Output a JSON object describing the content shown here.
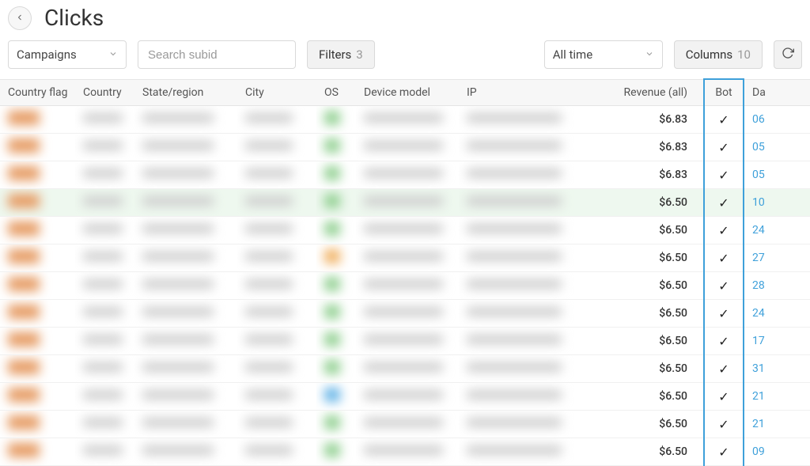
{
  "header": {
    "title": "Clicks"
  },
  "toolbar": {
    "campaigns_label": "Campaigns",
    "search_placeholder": "Search subid",
    "filters_label": "Filters",
    "filters_count": "3",
    "time_label": "All time",
    "columns_label": "Columns",
    "columns_count": "10"
  },
  "columns": {
    "flag": "Country flag",
    "country": "Country",
    "state": "State/region",
    "city": "City",
    "os": "OS",
    "device": "Device model",
    "ip": "IP",
    "revenue": "Revenue (all)",
    "bot": "Bot",
    "date": "Da"
  },
  "rows": [
    {
      "revenue": "$6.83",
      "bot": true,
      "date": "06",
      "highlight": false,
      "os_color": "green"
    },
    {
      "revenue": "$6.83",
      "bot": true,
      "date": "05",
      "highlight": false,
      "os_color": "green"
    },
    {
      "revenue": "$6.83",
      "bot": true,
      "date": "05",
      "highlight": false,
      "os_color": "green"
    },
    {
      "revenue": "$6.50",
      "bot": true,
      "date": "10",
      "highlight": true,
      "os_color": "green"
    },
    {
      "revenue": "$6.50",
      "bot": true,
      "date": "24",
      "highlight": false,
      "os_color": "green"
    },
    {
      "revenue": "$6.50",
      "bot": true,
      "date": "27",
      "highlight": false,
      "os_color": "orange"
    },
    {
      "revenue": "$6.50",
      "bot": true,
      "date": "28",
      "highlight": false,
      "os_color": "green"
    },
    {
      "revenue": "$6.50",
      "bot": true,
      "date": "24",
      "highlight": false,
      "os_color": "green"
    },
    {
      "revenue": "$6.50",
      "bot": true,
      "date": "17",
      "highlight": false,
      "os_color": "green"
    },
    {
      "revenue": "$6.50",
      "bot": true,
      "date": "31",
      "highlight": false,
      "os_color": "green"
    },
    {
      "revenue": "$6.50",
      "bot": true,
      "date": "21",
      "highlight": false,
      "os_color": "blue"
    },
    {
      "revenue": "$6.50",
      "bot": true,
      "date": "21",
      "highlight": false,
      "os_color": "green"
    },
    {
      "revenue": "$6.50",
      "bot": true,
      "date": "09",
      "highlight": false,
      "os_color": "green"
    }
  ]
}
